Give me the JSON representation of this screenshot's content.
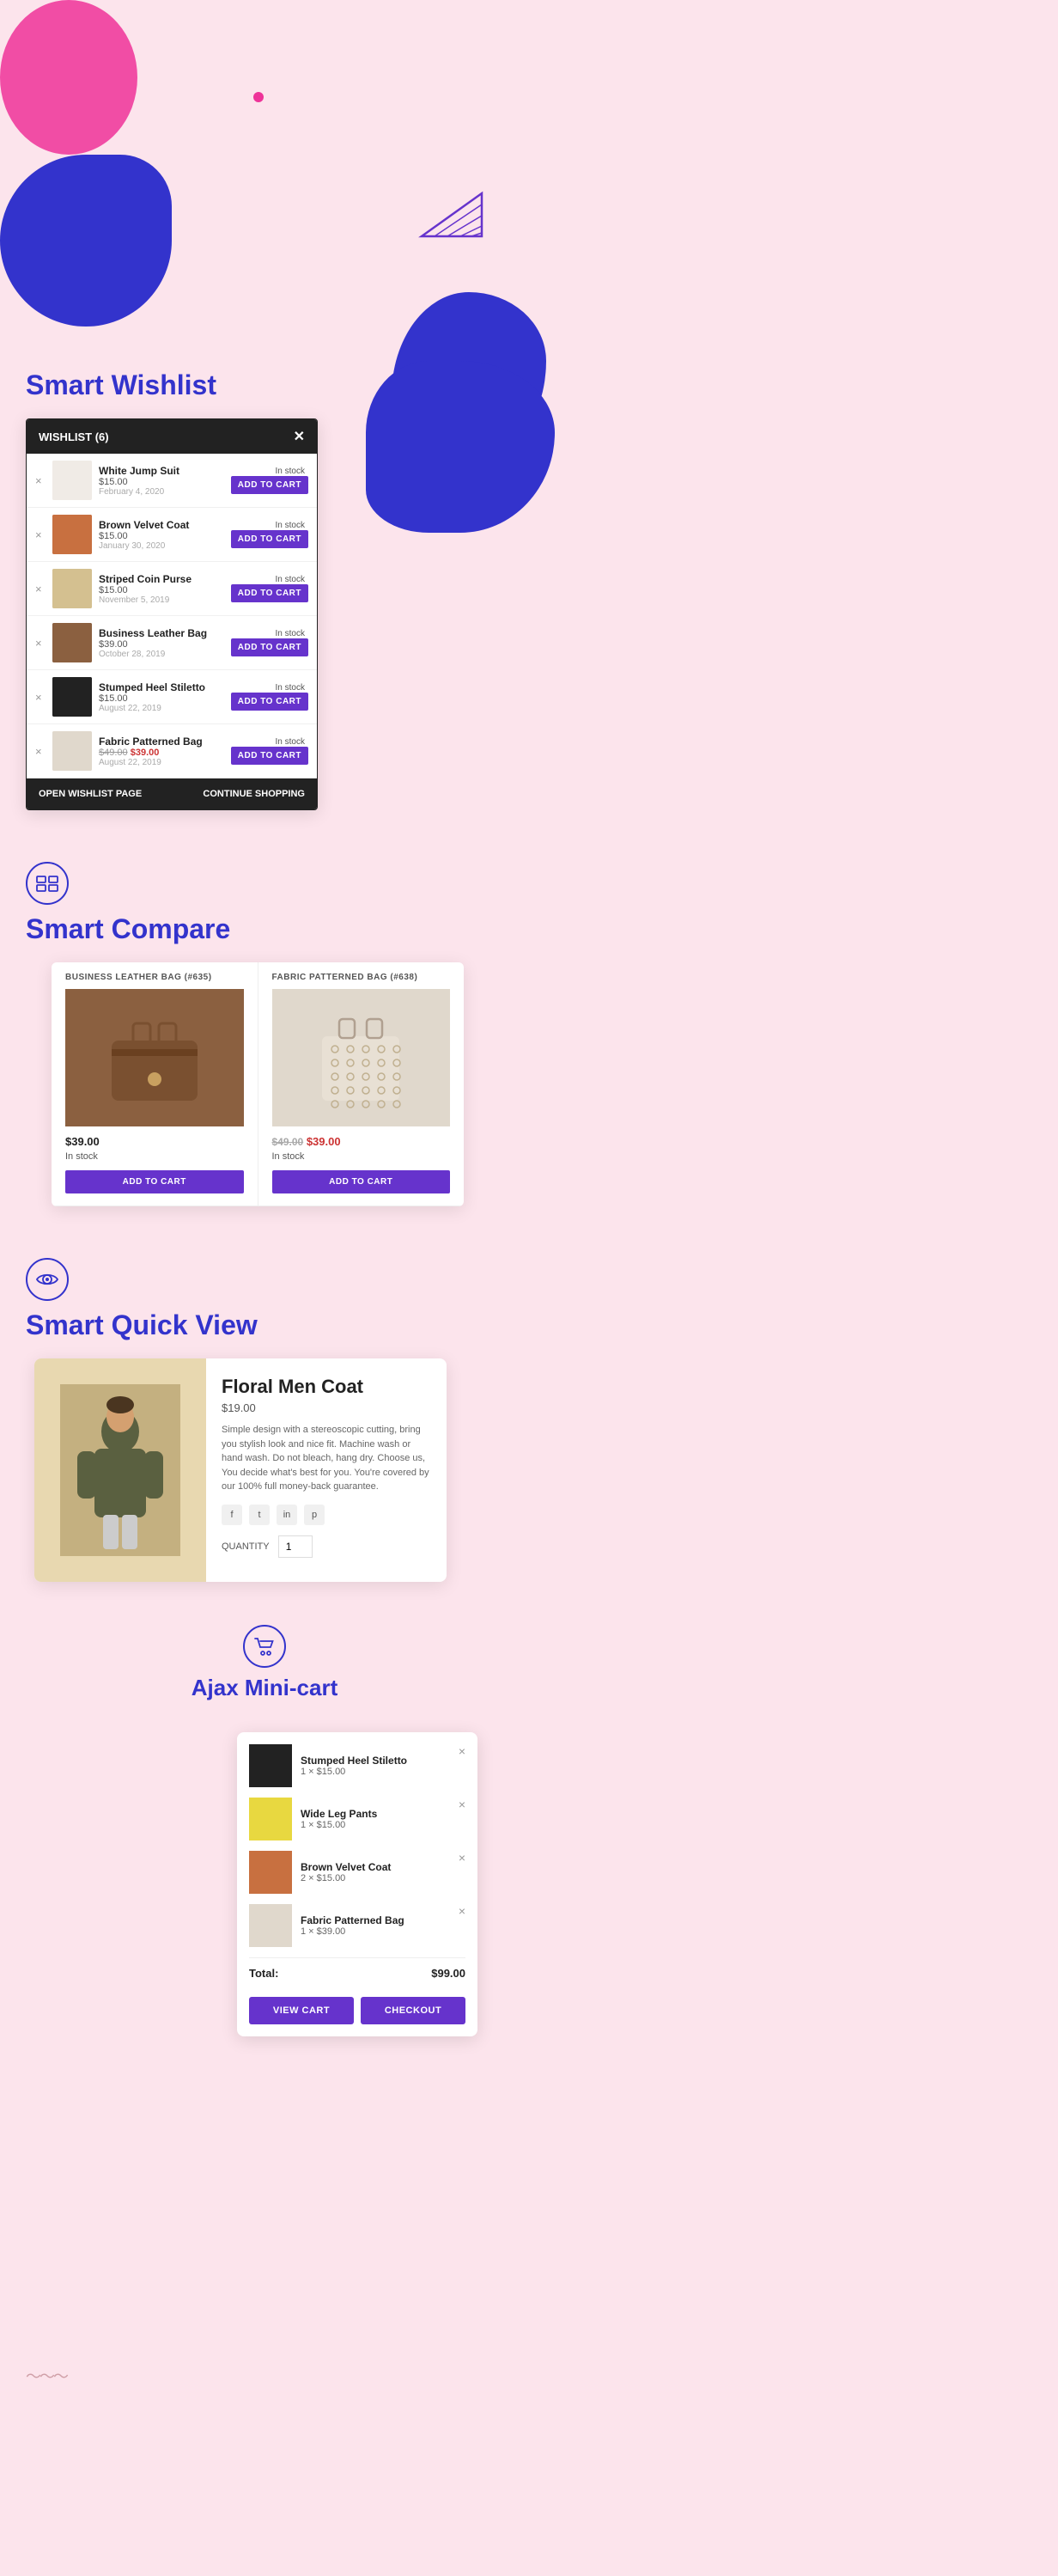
{
  "page": {
    "background": "#fce4ec"
  },
  "smartWishlist": {
    "sectionTitle": "Smart Wishlist",
    "widget": {
      "headerLabel": "WISHLIST (6)",
      "items": [
        {
          "name": "White Jump Suit",
          "price": "$15.00",
          "date": "February 4, 2020",
          "status": "In stock",
          "btnLabel": "ADD TO CART",
          "imgColor": "#f0ebe6"
        },
        {
          "name": "Brown Velvet Coat",
          "price": "$15.00",
          "date": "January 30, 2020",
          "status": "In stock",
          "btnLabel": "ADD TO CART",
          "imgColor": "#c87040"
        },
        {
          "name": "Striped Coin Purse",
          "price": "$15.00",
          "date": "November 5, 2019",
          "status": "In stock",
          "btnLabel": "ADD TO CART",
          "imgColor": "#d4c090"
        },
        {
          "name": "Business Leather Bag",
          "price": "$39.00",
          "date": "October 28, 2019",
          "status": "In stock",
          "btnLabel": "ADD TO CART",
          "imgColor": "#8B6040"
        },
        {
          "name": "Stumped Heel Stiletto",
          "price": "$15.00",
          "date": "August 22, 2019",
          "status": "In stock",
          "btnLabel": "ADD TO CART",
          "imgColor": "#222222"
        },
        {
          "name": "Fabric Patterned Bag",
          "priceOld": "$49.00",
          "price": "$39.00",
          "date": "August 22, 2019",
          "status": "In stock",
          "btnLabel": "ADD TO CART",
          "imgColor": "#e0d8cc"
        }
      ],
      "footerLeft": "OPEN WISHLIST PAGE",
      "footerRight": "CONTINUE SHOPPING"
    }
  },
  "smartCompare": {
    "sectionTitle": "Smart Compare",
    "widget": {
      "products": [
        {
          "id": "#635",
          "name": "BUSINESS LEATHER BAG (#635)",
          "price": "$39.00",
          "status": "In stock",
          "btnLabel": "ADD TO CART",
          "imgColor": "#8B6040"
        },
        {
          "id": "#638",
          "name": "FABRIC PATTERNED BAG (#638)",
          "priceOld": "$49.00",
          "price": "$39.00",
          "status": "In stock",
          "btnLabel": "ADD TO CART",
          "imgColor": "#e0d8cc"
        }
      ]
    }
  },
  "smartQuickView": {
    "sectionTitle": "Smart Quick View",
    "widget": {
      "productName": "Floral Men Coat",
      "price": "$19.00",
      "description": "Simple design with a stereoscopic cutting, bring you stylish look and nice fit. Machine wash or hand wash. Do not bleach, hang dry. Choose us, You decide what's best for you. You're covered by our 100% full money-back guarantee.",
      "quantityLabel": "QUANTITY",
      "quantityValue": "1",
      "imgColor": "#8B9060"
    }
  },
  "ajaxMiniCart": {
    "sectionTitle": "Ajax Mini-cart",
    "items": [
      {
        "name": "Stumped Heel Stiletto",
        "qty": "1",
        "price": "$15.00",
        "imgColor": "#222222"
      },
      {
        "name": "Wide Leg Pants",
        "qty": "1",
        "price": "$15.00",
        "imgColor": "#e8d840"
      },
      {
        "name": "Brown Velvet Coat",
        "qty": "2",
        "price": "$15.00",
        "imgColor": "#c87040"
      },
      {
        "name": "Fabric Patterned Bag",
        "qty": "1",
        "price": "$39.00",
        "imgColor": "#e0d8cc"
      }
    ],
    "totalLabel": "Total:",
    "totalValue": "$99.00",
    "viewCartLabel": "VIEW CART",
    "checkoutLabel": "CHECKOUT"
  }
}
